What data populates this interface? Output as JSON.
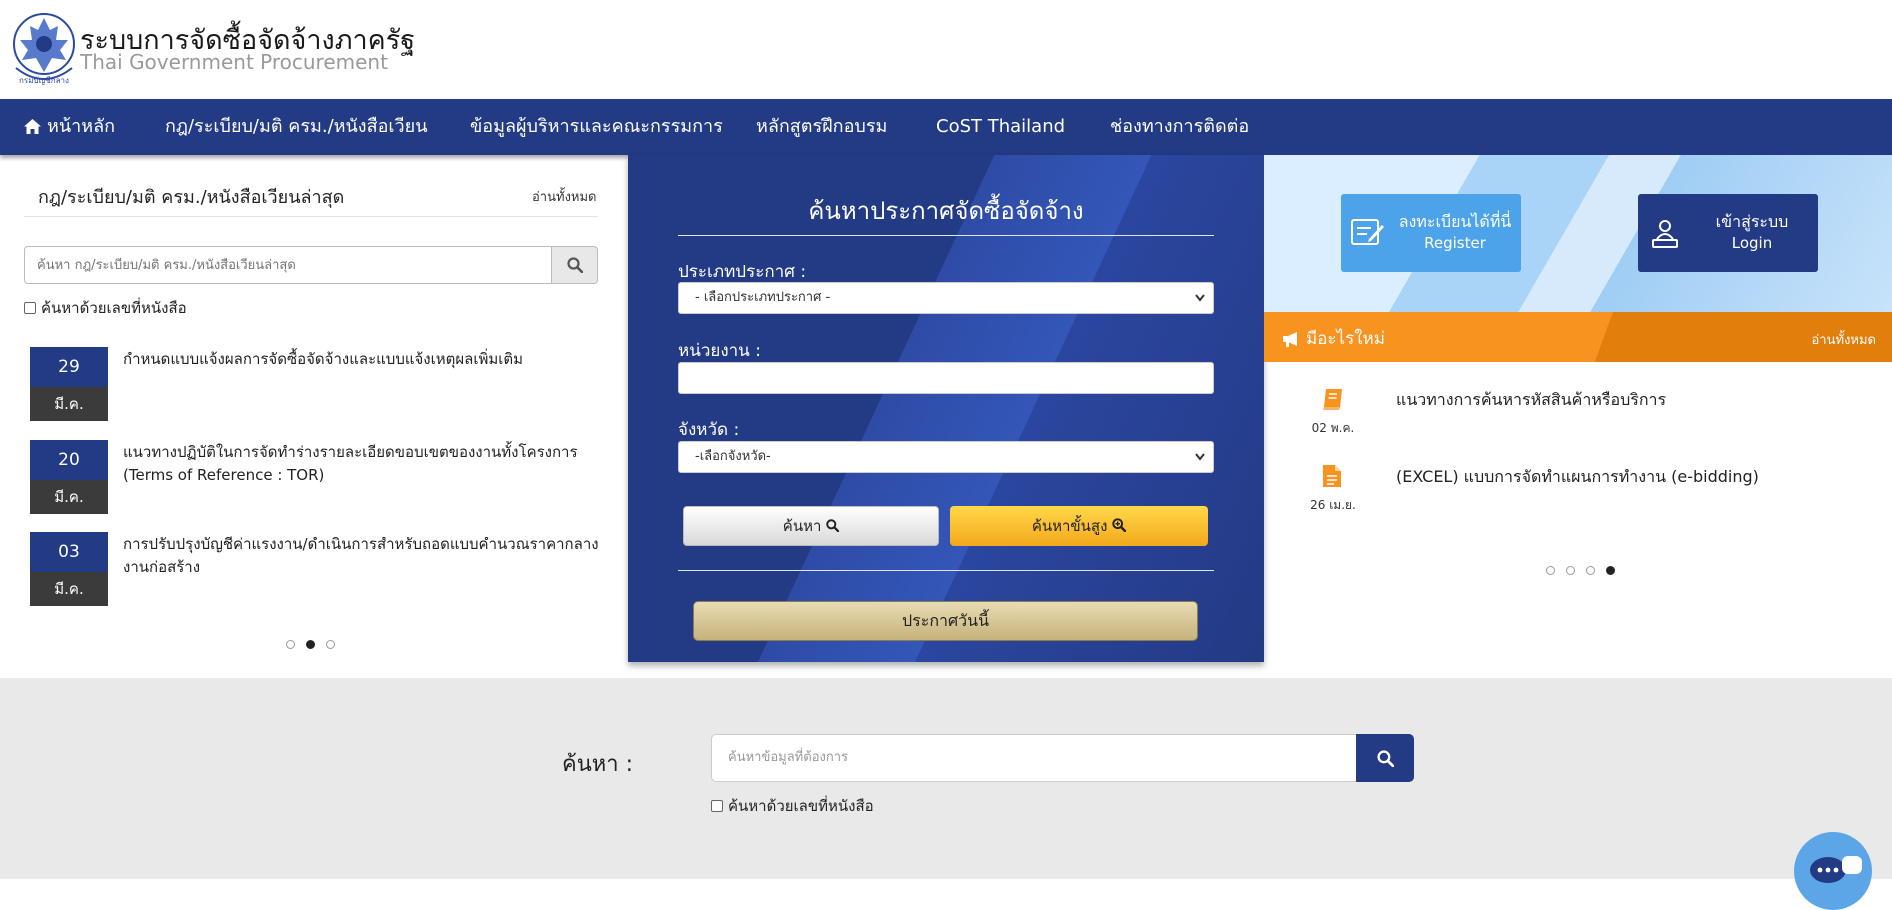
{
  "header": {
    "title": "ระบบการจัดซื้อจัดจ้างภาครัฐ",
    "subtitle": "Thai Government Procurement",
    "logo_text": "กรมบัญชีกลาง"
  },
  "nav": {
    "items": [
      {
        "label": "หน้าหลัก",
        "icon": "home-icon"
      },
      {
        "label": "กฎ/ระเบียบ/มติ ครม./หนังสือเวียน"
      },
      {
        "label": "ข้อมูลผู้บริหารและคณะกรรมการ"
      },
      {
        "label": "หลักสูตรฝึกอบรม"
      },
      {
        "label": "CoST Thailand"
      },
      {
        "label": "ช่องทางการติดต่อ"
      }
    ]
  },
  "regulations": {
    "title": "กฎ/ระเบียบ/มติ ครม./หนังสือเวียนล่าสุด",
    "read_all": "อ่านทั้งหมด",
    "search_placeholder": "ค้นหา กฎ/ระเบียบ/มติ ครม./หนังสือเวียนล่าสุด",
    "checkbox_label": "ค้นหาด้วยเลขที่หนังสือ",
    "items": [
      {
        "day": "29",
        "month": "มี.ค.",
        "text": "กำหนดแบบแจ้งผลการจัดซื้อจัดจ้างและแบบแจ้งเหตุผลเพิ่มเติม"
      },
      {
        "day": "20",
        "month": "มี.ค.",
        "text": "แนวทางปฏิบัติในการจัดทำร่างรายละเอียดขอบเขตของงานทั้งโครงการ (Terms of Reference : TOR)"
      },
      {
        "day": "03",
        "month": "มี.ค.",
        "text": "การปรับปรุงบัญชีค่าแรงงาน/ดำเนินการสำหรับถอดแบบคำนวณราคากลางงานก่อสร้าง"
      }
    ],
    "pager": {
      "count": 3,
      "active": 2
    }
  },
  "search_panel": {
    "title": "ค้นหาประกาศจัดซื้อจัดจ้าง",
    "type_label": "ประเภทประกาศ :",
    "type_value": "- เลือกประเภทประกาศ -",
    "agency_label": "หน่วยงาน :",
    "agency_value": "",
    "province_label": "จังหวัด :",
    "province_value": "-เลือกจังหวัด-",
    "search_button": "ค้นหา",
    "advanced_button": "ค้นหาขั้นสูง",
    "today_button": "ประกาศวันนี้"
  },
  "account": {
    "register_line1": "ลงทะเบียนได้ที่นี่",
    "register_line2": "Register",
    "login_line1": "เข้าสู่ระบบ",
    "login_line2": "Login"
  },
  "whats_new": {
    "title": "มีอะไรใหม่",
    "read_all": "อ่านทั้งหมด",
    "items": [
      {
        "date": "02 พ.ค.",
        "text": "แนวทางการค้นหารหัสสินค้าหรือบริการ",
        "icon": "book-icon"
      },
      {
        "date": "26 เม.ย.",
        "text": "(EXCEL) แบบการจัดทำแผนการทำงาน (e-bidding)",
        "icon": "file-icon"
      }
    ],
    "pager": {
      "count": 4,
      "active": 4
    }
  },
  "bottom_search": {
    "label": "ค้นหา :",
    "placeholder": "ค้นหาข้อมูลที่ต้องการ",
    "checkbox_label": "ค้นหาด้วยเลขที่หนังสือ"
  },
  "colors": {
    "nav": "#233a84",
    "orange": "#f7931e",
    "register": "#4da3ea",
    "advanced": "#f4a81c"
  }
}
